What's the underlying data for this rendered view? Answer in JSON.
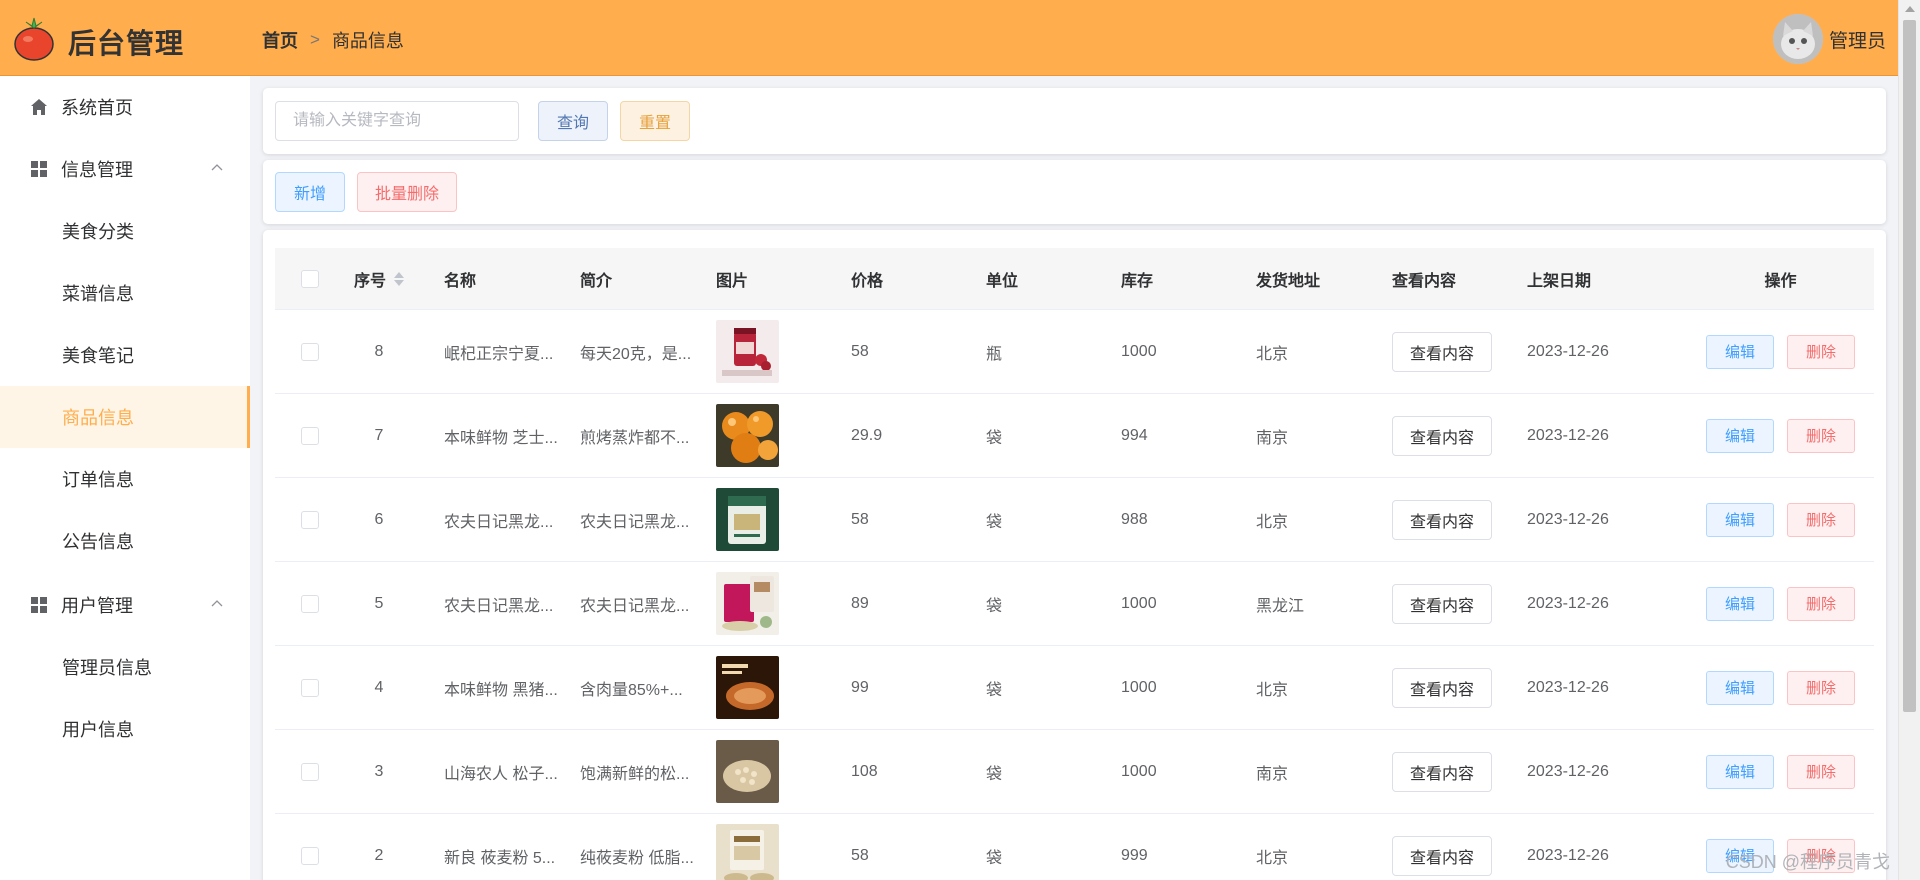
{
  "app": {
    "title": "后台管理",
    "user": "管理员"
  },
  "breadcrumb": {
    "home": "首页",
    "current": "商品信息"
  },
  "sidebar": {
    "home": "系统首页",
    "groups": [
      {
        "label": "信息管理",
        "items": [
          "美食分类",
          "菜谱信息",
          "美食笔记",
          "商品信息",
          "订单信息",
          "公告信息"
        ]
      },
      {
        "label": "用户管理",
        "items": [
          "管理员信息",
          "用户信息"
        ]
      }
    ],
    "active": "商品信息"
  },
  "search": {
    "placeholder": "请输入关键字查询",
    "value": "",
    "query_label": "查询",
    "reset_label": "重置"
  },
  "toolbar": {
    "add_label": "新增",
    "batch_delete_label": "批量删除"
  },
  "table": {
    "columns": [
      "序号",
      "名称",
      "简介",
      "图片",
      "价格",
      "单位",
      "库存",
      "发货地址",
      "查看内容",
      "上架日期",
      "操作"
    ],
    "view_label": "查看内容",
    "edit_label": "编辑",
    "delete_label": "删除",
    "rows": [
      {
        "seq": "8",
        "name": "岷杞正宗宁夏...",
        "desc": "每天20克，是...",
        "image": "goji-jar",
        "price": "58",
        "unit": "瓶",
        "stock": "1000",
        "address": "北京",
        "date": "2023-12-26"
      },
      {
        "seq": "7",
        "name": "本味鲜物 芝士...",
        "desc": "煎烤蒸炸都不...",
        "image": "cheese-balls",
        "price": "29.9",
        "unit": "袋",
        "stock": "994",
        "address": "南京",
        "date": "2023-12-26"
      },
      {
        "seq": "6",
        "name": "农夫日记黑龙...",
        "desc": "农夫日记黑龙...",
        "image": "green-rice-bag",
        "price": "58",
        "unit": "袋",
        "stock": "988",
        "address": "北京",
        "date": "2023-12-26"
      },
      {
        "seq": "5",
        "name": "农夫日记黑龙...",
        "desc": "农夫日记黑龙...",
        "image": "rice-bag",
        "price": "89",
        "unit": "袋",
        "stock": "1000",
        "address": "黑龙江",
        "date": "2023-12-26"
      },
      {
        "seq": "4",
        "name": "本味鲜物 黑猪...",
        "desc": "含肉量85%+...",
        "image": "sausage",
        "price": "99",
        "unit": "袋",
        "stock": "1000",
        "address": "北京",
        "date": "2023-12-26"
      },
      {
        "seq": "3",
        "name": "山海农人 松子...",
        "desc": "饱满新鲜的松...",
        "image": "pine-nuts",
        "price": "108",
        "unit": "袋",
        "stock": "1000",
        "address": "南京",
        "date": "2023-12-26"
      },
      {
        "seq": "2",
        "name": "新良 莜麦粉 5...",
        "desc": "纯莜麦粉 低脂...",
        "image": "oat-flour",
        "price": "58",
        "unit": "袋",
        "stock": "999",
        "address": "北京",
        "date": "2023-12-26"
      }
    ]
  },
  "watermark": "CSDN @程序员青戈",
  "colors": {
    "accent": "#ffad4d",
    "primary": "#409eff",
    "danger": "#f56c6c",
    "warning": "#e6a23c"
  }
}
